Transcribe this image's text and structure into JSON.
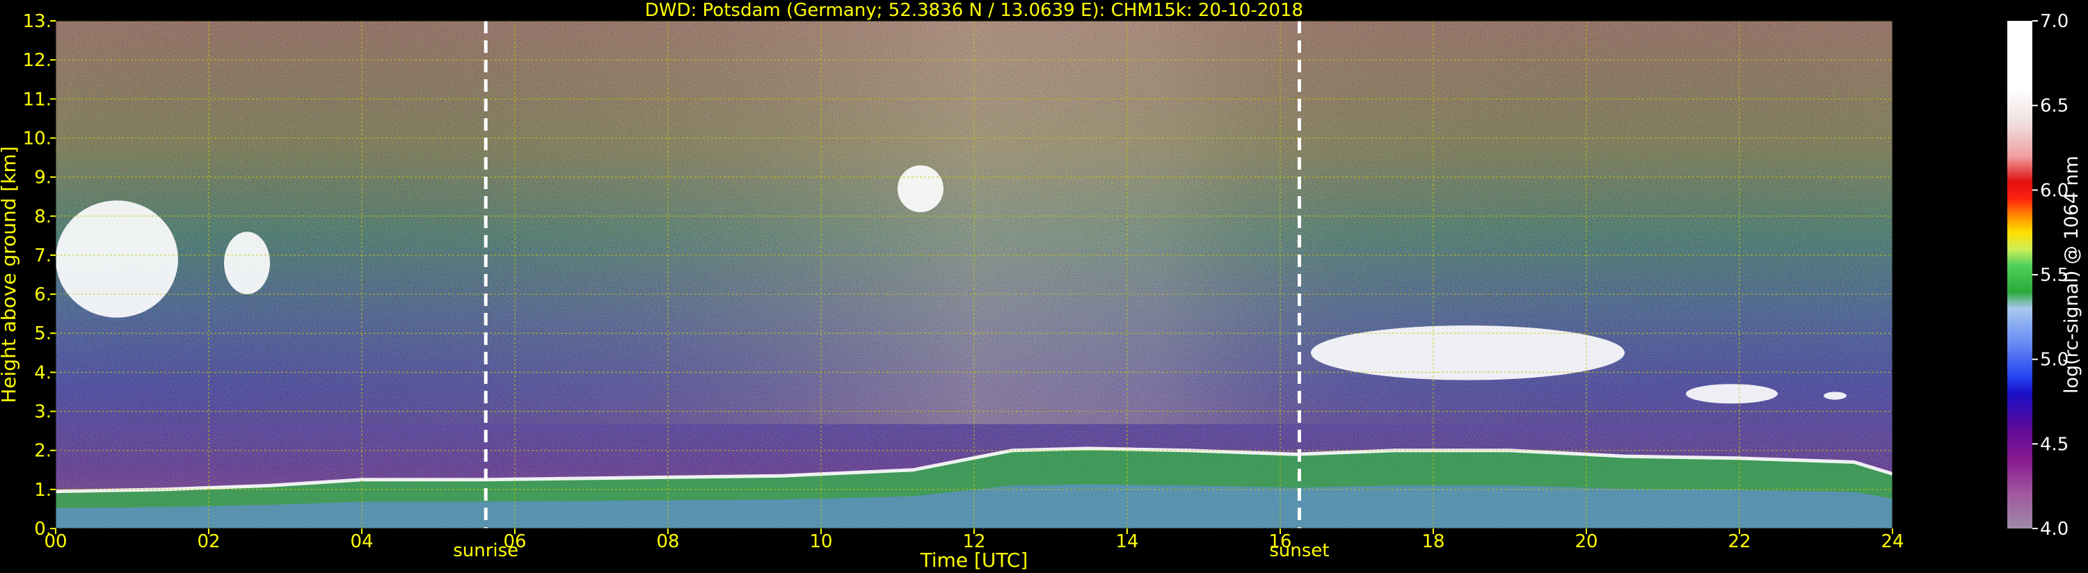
{
  "chart_data": {
    "type": "heatmap",
    "title": "DWD: Potsdam (Germany; 52.3836 N / 13.0639 E):    CHM15k: 20-10-2018",
    "xlabel": "Time [UTC]",
    "ylabel": "Height above ground [km]",
    "xlim": [
      0,
      24
    ],
    "ylim": [
      0,
      13
    ],
    "x_ticks": [
      {
        "value": 0,
        "label": "00"
      },
      {
        "value": 2,
        "label": "02"
      },
      {
        "value": 4,
        "label": "04"
      },
      {
        "value": 6,
        "label": "06"
      },
      {
        "value": 8,
        "label": "08"
      },
      {
        "value": 10,
        "label": "10"
      },
      {
        "value": 12,
        "label": "12"
      },
      {
        "value": 14,
        "label": "14"
      },
      {
        "value": 16,
        "label": "16"
      },
      {
        "value": 18,
        "label": "18"
      },
      {
        "value": 20,
        "label": "20"
      },
      {
        "value": 22,
        "label": "22"
      },
      {
        "value": 24,
        "label": "24"
      }
    ],
    "y_ticks": [
      {
        "value": 0,
        "label": "0."
      },
      {
        "value": 1,
        "label": "1."
      },
      {
        "value": 2,
        "label": "2."
      },
      {
        "value": 3,
        "label": "3."
      },
      {
        "value": 4,
        "label": "4."
      },
      {
        "value": 5,
        "label": "5."
      },
      {
        "value": 6,
        "label": "6."
      },
      {
        "value": 7,
        "label": "7."
      },
      {
        "value": 8,
        "label": "8."
      },
      {
        "value": 9,
        "label": "9."
      },
      {
        "value": 10,
        "label": "10."
      },
      {
        "value": 11,
        "label": "11."
      },
      {
        "value": 12,
        "label": "12."
      },
      {
        "value": 13,
        "label": "13."
      }
    ],
    "grid": true,
    "markers": [
      {
        "label": "sunrise",
        "time": 5.62
      },
      {
        "label": "sunset",
        "time": 16.25
      }
    ],
    "colorbar": {
      "label": "log(rc-signal) @ 1064 nm",
      "range": [
        4.0,
        7.0
      ],
      "ticks": [
        {
          "value": 4.0,
          "label": "4.0"
        },
        {
          "value": 4.5,
          "label": "4.5"
        },
        {
          "value": 5.0,
          "label": "5.0"
        },
        {
          "value": 5.5,
          "label": "5.5"
        },
        {
          "value": 6.0,
          "label": "6.0"
        },
        {
          "value": 6.5,
          "label": "6.5"
        },
        {
          "value": 7.0,
          "label": "7.0"
        }
      ],
      "color_stops": [
        {
          "value": 4.0,
          "color": "#a08aa6"
        },
        {
          "value": 4.2,
          "color": "#a15aa0"
        },
        {
          "value": 4.4,
          "color": "#8a1a8e"
        },
        {
          "value": 4.6,
          "color": "#5a0a9a"
        },
        {
          "value": 4.8,
          "color": "#1a10c8"
        },
        {
          "value": 4.9,
          "color": "#2545f0"
        },
        {
          "value": 5.1,
          "color": "#6a8cf5"
        },
        {
          "value": 5.3,
          "color": "#a8c8f0"
        },
        {
          "value": 5.4,
          "color": "#2aaa3a"
        },
        {
          "value": 5.55,
          "color": "#4cd05a"
        },
        {
          "value": 5.65,
          "color": "#cfee5a"
        },
        {
          "value": 5.75,
          "color": "#ffe000"
        },
        {
          "value": 5.85,
          "color": "#ff8800"
        },
        {
          "value": 5.95,
          "color": "#ff2010"
        },
        {
          "value": 6.05,
          "color": "#e01010"
        },
        {
          "value": 6.2,
          "color": "#f0a0a0"
        },
        {
          "value": 6.4,
          "color": "#f0e0e0"
        },
        {
          "value": 6.6,
          "color": "#ffffff"
        },
        {
          "value": 7.0,
          "color": "#ffffff"
        }
      ]
    },
    "features": {
      "boundary_layer_top_km": [
        [
          0,
          0.95
        ],
        [
          1.4,
          1.0
        ],
        [
          2.8,
          1.1
        ],
        [
          4,
          1.25
        ],
        [
          5.6,
          1.25
        ],
        [
          7.5,
          1.3
        ],
        [
          9.5,
          1.35
        ],
        [
          11.2,
          1.5
        ],
        [
          12.5,
          2.0
        ],
        [
          13.5,
          2.05
        ],
        [
          14.8,
          2.0
        ],
        [
          16.2,
          1.9
        ],
        [
          17.5,
          2.0
        ],
        [
          19,
          2.0
        ],
        [
          20.5,
          1.85
        ],
        [
          22,
          1.8
        ],
        [
          23.5,
          1.7
        ],
        [
          24,
          1.4
        ]
      ],
      "clouds": [
        {
          "t_start": 0.0,
          "t_end": 1.6,
          "base_km": 5.4,
          "top_km": 8.4
        },
        {
          "t_start": 2.2,
          "t_end": 2.8,
          "base_km": 6.0,
          "top_km": 7.6
        },
        {
          "t_start": 11.0,
          "t_end": 11.6,
          "base_km": 8.1,
          "top_km": 9.3
        },
        {
          "t_start": 16.4,
          "t_end": 20.5,
          "base_km": 3.8,
          "top_km": 5.2
        },
        {
          "t_start": 21.3,
          "t_end": 22.5,
          "base_km": 3.2,
          "top_km": 3.7
        },
        {
          "t_start": 23.1,
          "t_end": 23.4,
          "base_km": 3.3,
          "top_km": 3.5
        }
      ]
    },
    "colors": {
      "text": "#ffff00",
      "colorbar_text": "#ffffff",
      "grid": "#c8c800",
      "markers": "#ffffff",
      "background": "#000000"
    }
  }
}
